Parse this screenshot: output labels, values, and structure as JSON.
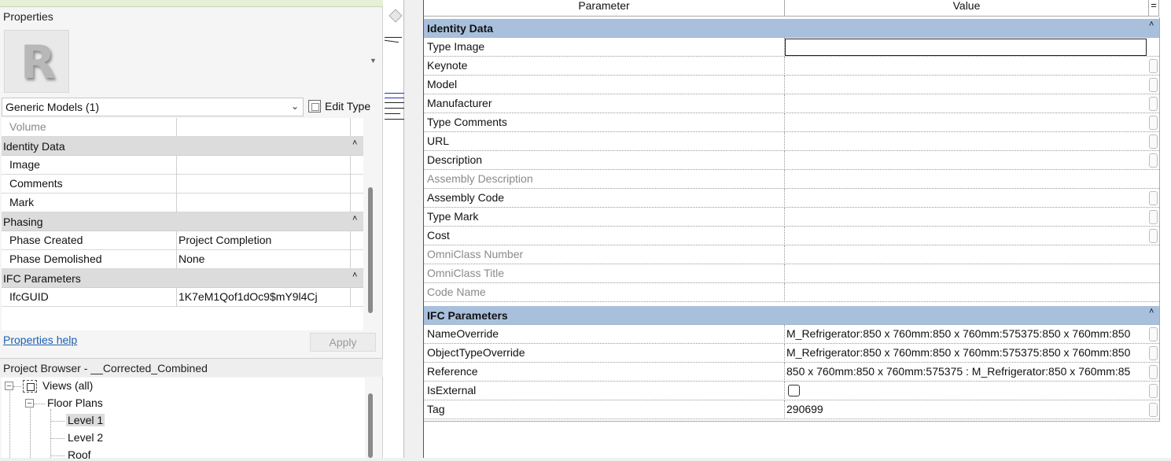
{
  "properties_panel": {
    "title": "Properties",
    "type_selector": "Generic Models (1)",
    "edit_type_label": "Edit Type",
    "rows": [
      {
        "kind": "prop",
        "key": "Volume",
        "value": "",
        "dim": true
      },
      {
        "kind": "group",
        "key": "Identity Data"
      },
      {
        "kind": "prop",
        "key": "Image",
        "value": ""
      },
      {
        "kind": "prop",
        "key": "Comments",
        "value": ""
      },
      {
        "kind": "prop",
        "key": "Mark",
        "value": ""
      },
      {
        "kind": "group",
        "key": "Phasing"
      },
      {
        "kind": "prop",
        "key": "Phase Created",
        "value": "Project Completion"
      },
      {
        "kind": "prop",
        "key": "Phase Demolished",
        "value": "None"
      },
      {
        "kind": "group",
        "key": "IFC Parameters"
      },
      {
        "kind": "prop",
        "key": "IfcGUID",
        "value": "1K7eM1Qof1dOc9$mY9l4Cj"
      }
    ],
    "help_link": "Properties help",
    "apply_label": "Apply"
  },
  "project_browser": {
    "title": "Project Browser - __Corrected_Combined",
    "tree": {
      "views_label": "Views (all)",
      "floor_plans_label": "Floor Plans",
      "levels": [
        "Level 1",
        "Level 2",
        "Roof"
      ],
      "selected": "Level 1"
    }
  },
  "type_params": {
    "headers": {
      "parameter": "Parameter",
      "value": "Value",
      "eq": "="
    },
    "groups": [
      {
        "title": "Identity Data",
        "rows": [
          {
            "key": "Type Image",
            "value": "",
            "editing": true
          },
          {
            "key": "Keynote",
            "value": "",
            "button": true
          },
          {
            "key": "Model",
            "value": "",
            "button": true
          },
          {
            "key": "Manufacturer",
            "value": "",
            "button": true
          },
          {
            "key": "Type Comments",
            "value": "",
            "button": true
          },
          {
            "key": "URL",
            "value": "",
            "button": true
          },
          {
            "key": "Description",
            "value": "",
            "button": true
          },
          {
            "key": "Assembly Description",
            "value": "",
            "dim": true
          },
          {
            "key": "Assembly Code",
            "value": "",
            "button": true
          },
          {
            "key": "Type Mark",
            "value": "",
            "button": true
          },
          {
            "key": "Cost",
            "value": "",
            "button": true
          },
          {
            "key": "OmniClass Number",
            "value": "",
            "dim": true
          },
          {
            "key": "OmniClass Title",
            "value": "",
            "dim": true
          },
          {
            "key": "Code Name",
            "value": "",
            "dim": true
          }
        ]
      },
      {
        "title": "IFC Parameters",
        "rows": [
          {
            "key": "NameOverride",
            "value": "M_Refrigerator:850 x 760mm:850 x 760mm:575375:850 x 760mm:850",
            "button": true
          },
          {
            "key": "ObjectTypeOverride",
            "value": "M_Refrigerator:850 x 760mm:850 x 760mm:575375:850 x 760mm:850",
            "button": true
          },
          {
            "key": "Reference",
            "value": "850 x 760mm:850 x 760mm:575375 : M_Refrigerator:850 x 760mm:85",
            "button": true
          },
          {
            "key": "IsExternal",
            "value": "",
            "checkbox": true,
            "checked": false,
            "button": true
          },
          {
            "key": "Tag",
            "value": "290699",
            "button": true
          }
        ]
      }
    ]
  }
}
